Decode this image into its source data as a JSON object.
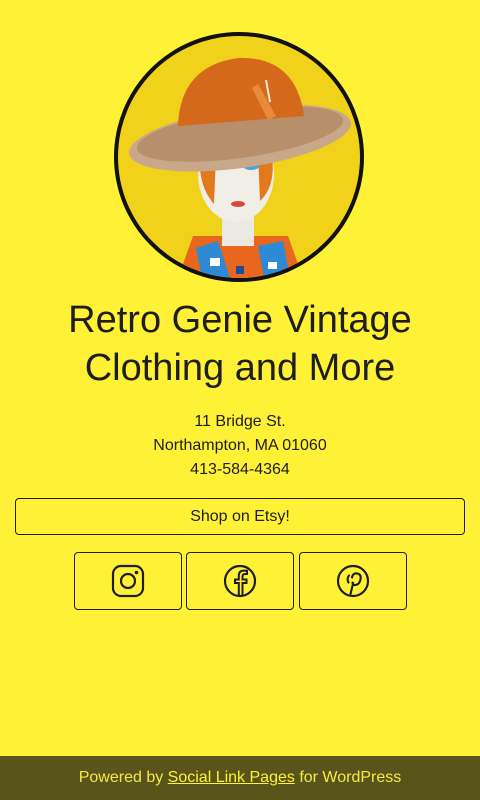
{
  "profile": {
    "avatar_alt": "Retro Genie Vintage avatar"
  },
  "site": {
    "title": "Retro Genie Vintage Clothing and More"
  },
  "contact": {
    "street": "11 Bridge St.",
    "city_state_zip": "Northampton, MA 01060",
    "phone": "413-584-4364"
  },
  "links": {
    "etsy_label": "Shop on Etsy!"
  },
  "social": [
    {
      "name": "Instagram",
      "icon": "instagram-icon"
    },
    {
      "name": "Facebook",
      "icon": "facebook-icon"
    },
    {
      "name": "Pinterest",
      "icon": "pinterest-icon"
    }
  ],
  "footer": {
    "prefix": "Powered by",
    "link_label": "Social Link Pages",
    "suffix": "for WordPress"
  },
  "colors": {
    "background": "#fff135",
    "text": "#1e1e1e",
    "footer_bg": "#59541a"
  }
}
